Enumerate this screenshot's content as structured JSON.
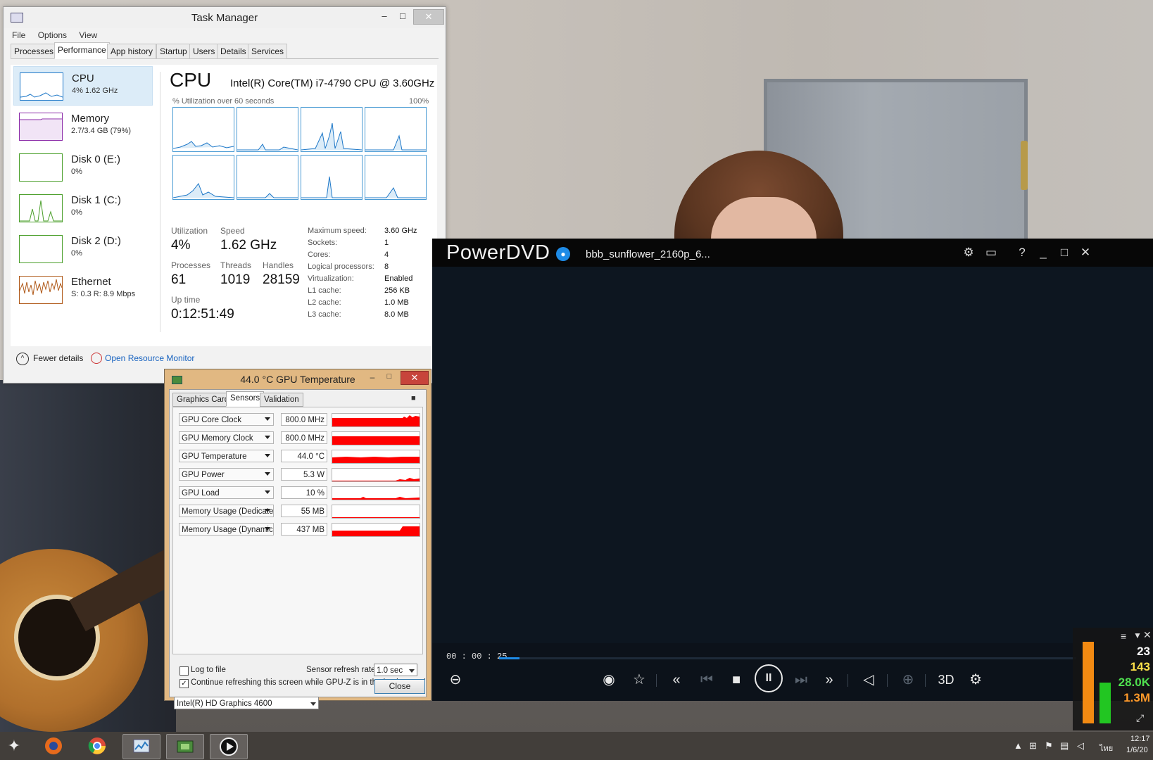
{
  "task_manager": {
    "title": "Task Manager",
    "window_controls": {
      "minimize": "–",
      "maximize": "□",
      "close": "✕"
    },
    "menu": [
      "File",
      "Options",
      "View"
    ],
    "tabs": [
      "Processes",
      "Performance",
      "App history",
      "Startup",
      "Users",
      "Details",
      "Services"
    ],
    "active_tab": "Performance",
    "sidebar": [
      {
        "name": "CPU",
        "sub": "4% 1.62 GHz",
        "color": "#1e78c8"
      },
      {
        "name": "Memory",
        "sub": "2.7/3.4 GB (79%)",
        "color": "#8b2aa8"
      },
      {
        "name": "Disk 0 (E:)",
        "sub": "0%",
        "color": "#4ca02c"
      },
      {
        "name": "Disk 1 (C:)",
        "sub": "0%",
        "color": "#4ca02c"
      },
      {
        "name": "Disk 2 (D:)",
        "sub": "0%",
        "color": "#4ca02c"
      },
      {
        "name": "Ethernet",
        "sub": "S: 0.3 R: 8.9 Mbps",
        "color": "#b05a1a"
      }
    ],
    "cpu": {
      "heading": "CPU",
      "model": "Intel(R) Core(TM) i7-4790 CPU @ 3.60GHz",
      "util_label": "% Utilization over 60 seconds",
      "util_max": "100%",
      "stats": {
        "utilization_label": "Utilization",
        "utilization": "4%",
        "speed_label": "Speed",
        "speed": "1.62 GHz",
        "processes_label": "Processes",
        "processes": "61",
        "threads_label": "Threads",
        "threads": "1019",
        "handles_label": "Handles",
        "handles": "28159",
        "uptime_label": "Up time",
        "uptime": "0:12:51:49"
      },
      "specs": [
        {
          "k": "Maximum speed:",
          "v": "3.60 GHz"
        },
        {
          "k": "Sockets:",
          "v": "1"
        },
        {
          "k": "Cores:",
          "v": "4"
        },
        {
          "k": "Logical processors:",
          "v": "8"
        },
        {
          "k": "Virtualization:",
          "v": "Enabled"
        },
        {
          "k": "L1 cache:",
          "v": "256 KB"
        },
        {
          "k": "L2 cache:",
          "v": "1.0 MB"
        },
        {
          "k": "L3 cache:",
          "v": "8.0 MB"
        }
      ]
    },
    "footer": {
      "fewer_details": "Fewer details",
      "open_resource_monitor": "Open Resource Monitor"
    }
  },
  "gpuz": {
    "title": "44.0 °C GPU Temperature",
    "window_controls": {
      "minimize": "–",
      "maximize": "□",
      "close": "✕"
    },
    "tabs": [
      "Graphics Card",
      "Sensors",
      "Validation"
    ],
    "active_tab": "Sensors",
    "sensors": [
      {
        "name": "GPU Core Clock",
        "value": "800.0 MHz",
        "level": 0.85
      },
      {
        "name": "GPU Memory Clock",
        "value": "800.0 MHz",
        "level": 0.7
      },
      {
        "name": "GPU Temperature",
        "value": "44.0 °C",
        "level": 0.45
      },
      {
        "name": "GPU Power",
        "value": "5.3 W",
        "level": 0.2
      },
      {
        "name": "GPU Load",
        "value": "10 %",
        "level": 0.1
      },
      {
        "name": "Memory Usage (Dedicated)",
        "value": "55 MB",
        "level": 0.05
      },
      {
        "name": "Memory Usage (Dynamic)",
        "value": "437 MB",
        "level": 0.55
      }
    ],
    "log_to_file": "Log to file",
    "refresh_label": "Sensor refresh rate:",
    "refresh_value": "1.0 sec",
    "continue_label": "Continue refreshing this screen while GPU-Z is in the background",
    "device": "Intel(R) HD Graphics 4600",
    "close_button": "Close"
  },
  "powerdvd": {
    "logo": "PowerDVD",
    "file": "bbb_sunflower_2160p_6...",
    "time": "00 : 00 : 25",
    "progress": 0.035,
    "label_3d": "3D",
    "accent": "#1e8be6"
  },
  "overlay_meter": {
    "values": [
      "23",
      "143",
      "28.0K",
      "1.3M"
    ],
    "colors": [
      "#ffffff",
      "#ffe24a",
      "#4fe04f",
      "#ff9a2a"
    ]
  },
  "taskbar": {
    "tray_time": "12:17",
    "tray_date": "1/6/20",
    "language": "ไทย"
  }
}
